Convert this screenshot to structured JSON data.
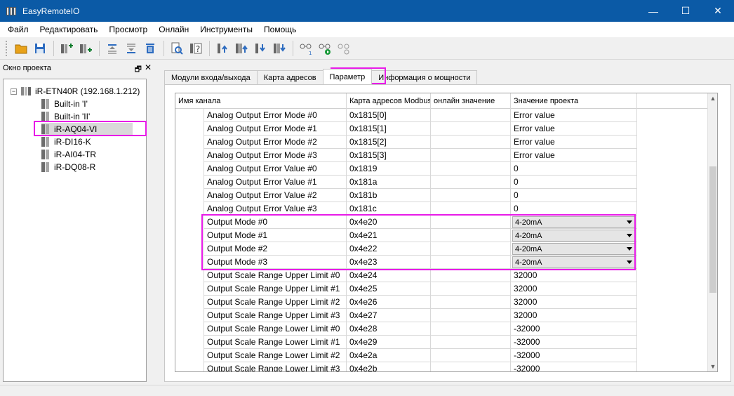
{
  "window": {
    "title": "EasyRemoteIO",
    "minimize": "—",
    "maximize": "☐",
    "close": "✕"
  },
  "menu": [
    "Файл",
    "Редактировать",
    "Просмотр",
    "Онлайн",
    "Инструменты",
    "Помощь"
  ],
  "toolbar_icons": [
    "open-folder-icon",
    "save-icon",
    "add-module-icon",
    "insert-module-icon",
    "move-up-icon",
    "move-down-icon",
    "delete-icon",
    "search-icon",
    "help-icon",
    "upload-icon",
    "upload-all-icon",
    "download-icon",
    "download-all-icon",
    "connect-icon",
    "connect-run-icon",
    "disconnect-icon"
  ],
  "project_pane": {
    "title": "Окно проекта",
    "pin": "🗗",
    "close": "✕",
    "root": {
      "expander": "−",
      "label": "iR-ETN40R (192.168.1.212)"
    },
    "children": [
      "Built-in 'I'",
      "Built-in 'II'",
      "iR-AQ04-VI",
      "iR-DI16-K",
      "iR-AI04-TR",
      "iR-DQ08-R"
    ],
    "selected": "iR-AQ04-VI"
  },
  "tabs": [
    {
      "label": "Модули входа/выхода",
      "active": false
    },
    {
      "label": "Карта адресов",
      "active": false
    },
    {
      "label": "Параметр",
      "active": true
    },
    {
      "label": "Информация о мощности",
      "active": false
    }
  ],
  "grid": {
    "headers": {
      "name": "Имя канала",
      "address": "Карта адресов Modbus",
      "online": "онлайн значение",
      "project": "Значение проекта"
    },
    "rows": [
      {
        "name": "Analog Output Error Mode #0",
        "address": "0x1815[0]",
        "online": "",
        "project": "Error value",
        "dropdown": false
      },
      {
        "name": "Analog Output Error Mode #1",
        "address": "0x1815[1]",
        "online": "",
        "project": "Error value",
        "dropdown": false
      },
      {
        "name": "Analog Output Error Mode #2",
        "address": "0x1815[2]",
        "online": "",
        "project": "Error value",
        "dropdown": false
      },
      {
        "name": "Analog Output Error Mode #3",
        "address": "0x1815[3]",
        "online": "",
        "project": "Error value",
        "dropdown": false
      },
      {
        "name": "Analog Output Error Value #0",
        "address": "0x1819",
        "online": "",
        "project": "0",
        "dropdown": false
      },
      {
        "name": "Analog Output Error Value #1",
        "address": "0x181a",
        "online": "",
        "project": "0",
        "dropdown": false
      },
      {
        "name": "Analog Output Error Value #2",
        "address": "0x181b",
        "online": "",
        "project": "0",
        "dropdown": false
      },
      {
        "name": "Analog Output Error Value #3",
        "address": "0x181c",
        "online": "",
        "project": "0",
        "dropdown": false
      },
      {
        "name": "Output Mode #0",
        "address": "0x4e20",
        "online": "",
        "project": "4-20mA",
        "dropdown": true
      },
      {
        "name": "Output Mode #1",
        "address": "0x4e21",
        "online": "",
        "project": "4-20mA",
        "dropdown": true
      },
      {
        "name": "Output Mode #2",
        "address": "0x4e22",
        "online": "",
        "project": "4-20mA",
        "dropdown": true
      },
      {
        "name": "Output Mode #3",
        "address": "0x4e23",
        "online": "",
        "project": "4-20mA",
        "dropdown": true
      },
      {
        "name": "Output Scale Range Upper Limit #0",
        "address": "0x4e24",
        "online": "",
        "project": "32000",
        "dropdown": false
      },
      {
        "name": "Output Scale Range Upper Limit #1",
        "address": "0x4e25",
        "online": "",
        "project": "32000",
        "dropdown": false
      },
      {
        "name": "Output Scale Range Upper Limit #2",
        "address": "0x4e26",
        "online": "",
        "project": "32000",
        "dropdown": false
      },
      {
        "name": "Output Scale Range Upper Limit #3",
        "address": "0x4e27",
        "online": "",
        "project": "32000",
        "dropdown": false
      },
      {
        "name": "Output Scale Range Lower Limit #0",
        "address": "0x4e28",
        "online": "",
        "project": "-32000",
        "dropdown": false
      },
      {
        "name": "Output Scale Range Lower Limit #1",
        "address": "0x4e29",
        "online": "",
        "project": "-32000",
        "dropdown": false
      },
      {
        "name": "Output Scale Range Lower Limit #2",
        "address": "0x4e2a",
        "online": "",
        "project": "-32000",
        "dropdown": false
      },
      {
        "name": "Output Scale Range Lower Limit #3",
        "address": "0x4e2b",
        "online": "",
        "project": "-32000",
        "dropdown": false
      }
    ]
  },
  "scrollbar": {
    "up": "▲",
    "down": "▼"
  },
  "colors": {
    "titlebar": "#0b5aa6",
    "highlight": "#e81be8"
  }
}
